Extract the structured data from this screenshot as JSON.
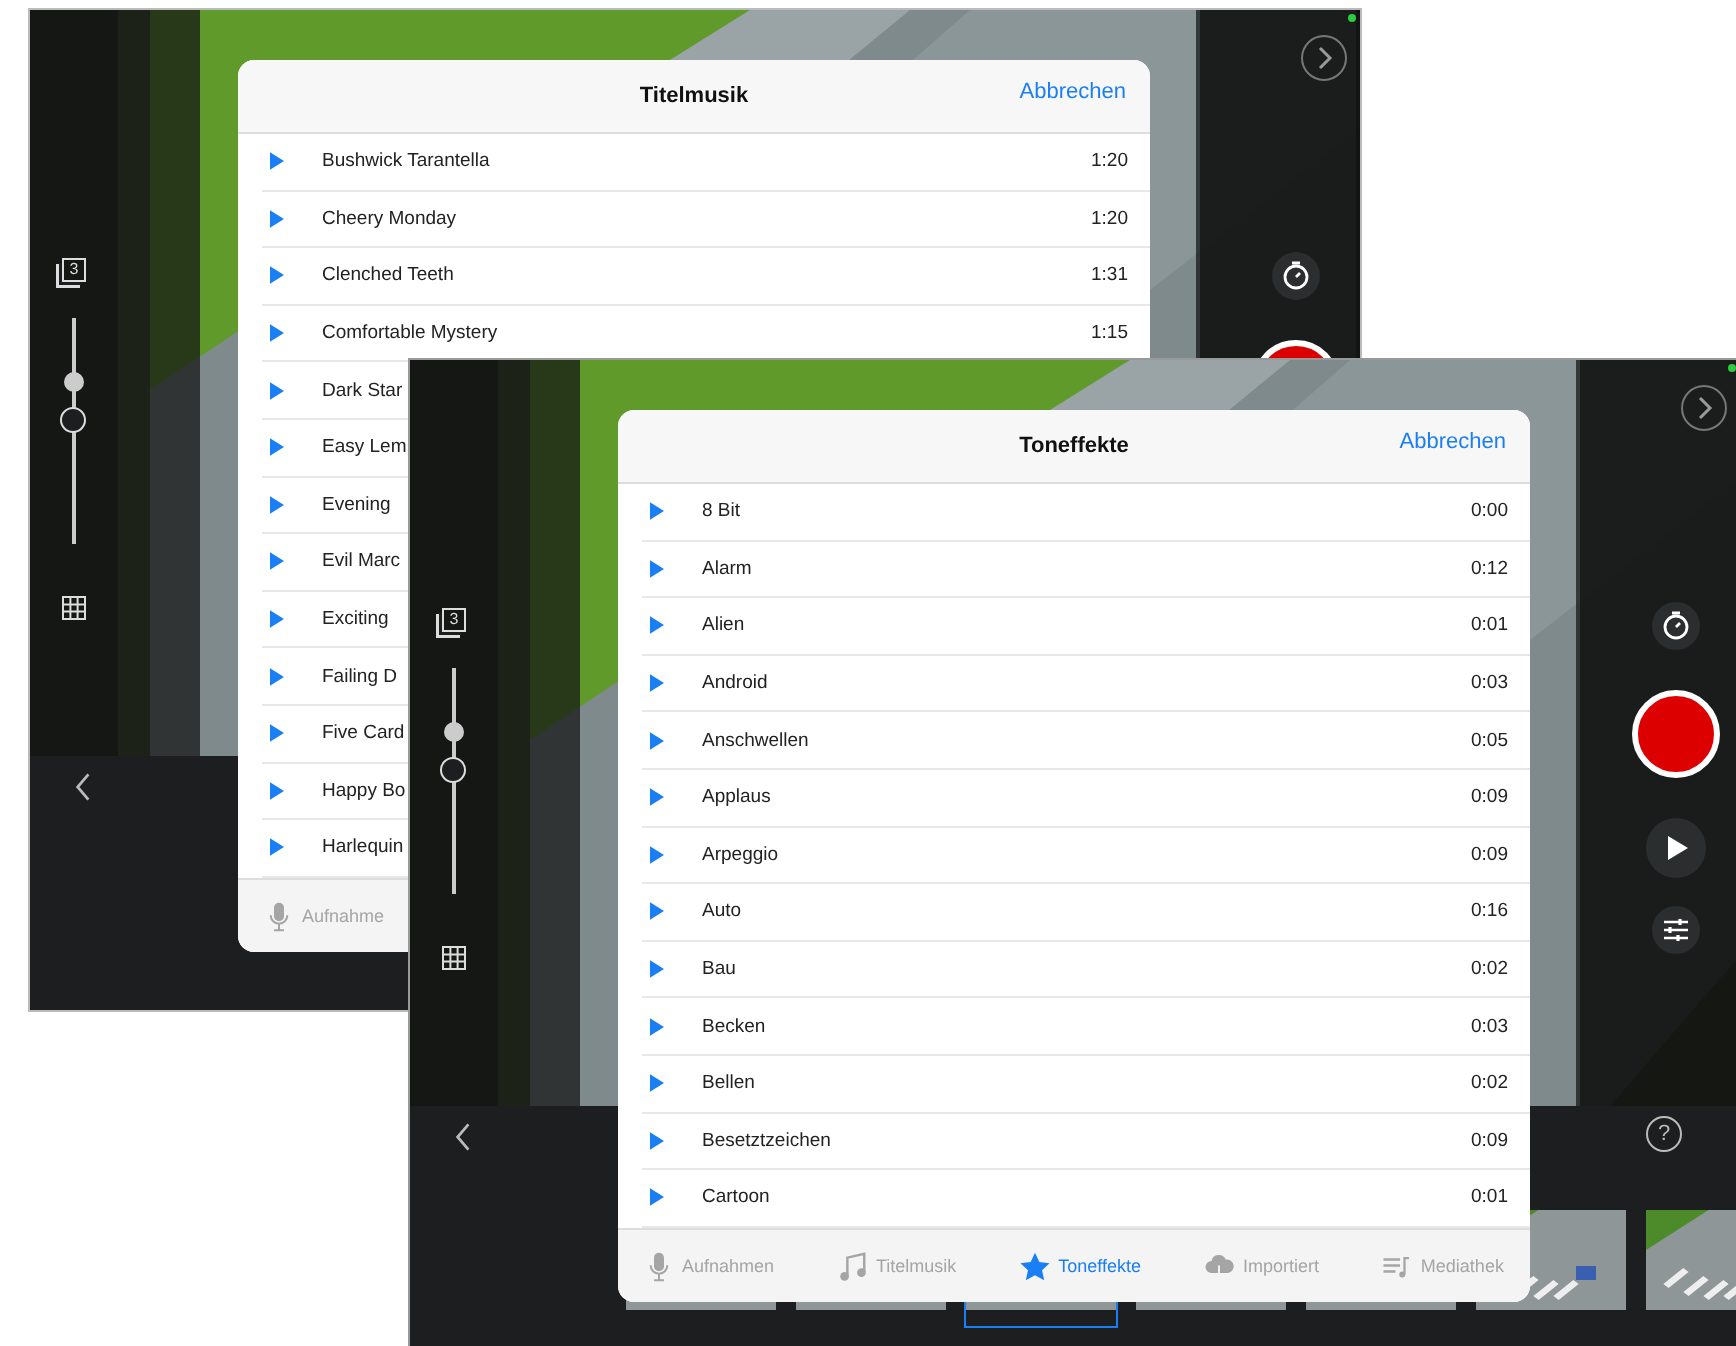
{
  "screens": [
    {
      "layer_count": "3",
      "slider": {
        "level": 0.5
      },
      "right_controls": [
        {
          "kind": "next"
        },
        {
          "kind": "timer"
        },
        {
          "kind": "record"
        }
      ],
      "bottom_controls": [
        {
          "kind": "back"
        }
      ],
      "popup": {
        "title": "Titelmusik",
        "cancel": "Abbrechen",
        "rows": [
          {
            "name": "Bushwick Tarantella",
            "duration": "1:20"
          },
          {
            "name": "Cheery Monday",
            "duration": "1:20"
          },
          {
            "name": "Clenched Teeth",
            "duration": "1:31"
          },
          {
            "name": "Comfortable Mystery",
            "duration": "1:15"
          },
          {
            "name": "Dark Star"
          },
          {
            "name": "Easy Lem"
          },
          {
            "name": "Evening"
          },
          {
            "name": "Evil Marc"
          },
          {
            "name": "Exciting"
          },
          {
            "name": "Failing D"
          },
          {
            "name": "Five Card"
          },
          {
            "name": "Happy Bo"
          },
          {
            "name": "Harlequin"
          }
        ],
        "tabs": [
          {
            "kind": "mic",
            "label": "Aufnahme",
            "selected": false
          }
        ]
      }
    },
    {
      "layer_count": "3",
      "slider": {
        "level": 0.5
      },
      "right_controls": [
        {
          "kind": "next"
        },
        {
          "kind": "timer"
        },
        {
          "kind": "record"
        },
        {
          "kind": "play"
        },
        {
          "kind": "adjust"
        }
      ],
      "bottom_controls": [
        {
          "kind": "back"
        },
        {
          "kind": "help",
          "label": "?"
        }
      ],
      "thumbnails": [
        {
          "selected": false
        },
        {
          "selected": false
        },
        {
          "selected": true
        },
        {
          "selected": false
        },
        {
          "selected": false
        },
        {
          "selected": false
        },
        {
          "selected": false
        }
      ],
      "popup": {
        "title": "Toneffekte",
        "cancel": "Abbrechen",
        "rows": [
          {
            "name": "8 Bit",
            "duration": "0:00"
          },
          {
            "name": "Alarm",
            "duration": "0:12"
          },
          {
            "name": "Alien",
            "duration": "0:01"
          },
          {
            "name": "Android",
            "duration": "0:03"
          },
          {
            "name": "Anschwellen",
            "duration": "0:05"
          },
          {
            "name": "Applaus",
            "duration": "0:09"
          },
          {
            "name": "Arpeggio",
            "duration": "0:09"
          },
          {
            "name": "Auto",
            "duration": "0:16"
          },
          {
            "name": "Bau",
            "duration": "0:02"
          },
          {
            "name": "Becken",
            "duration": "0:03"
          },
          {
            "name": "Bellen",
            "duration": "0:02"
          },
          {
            "name": "Besetztzeichen",
            "duration": "0:09"
          },
          {
            "name": "Cartoon",
            "duration": "0:01"
          }
        ],
        "tabs": [
          {
            "kind": "mic",
            "label": "Aufnahmen",
            "selected": false
          },
          {
            "kind": "note",
            "label": "Titelmusik",
            "selected": false
          },
          {
            "kind": "star",
            "label": "Toneffekte",
            "selected": true
          },
          {
            "kind": "cloud",
            "label": "Importiert",
            "selected": false
          },
          {
            "kind": "library",
            "label": "Mediathek",
            "selected": false
          }
        ]
      }
    }
  ]
}
